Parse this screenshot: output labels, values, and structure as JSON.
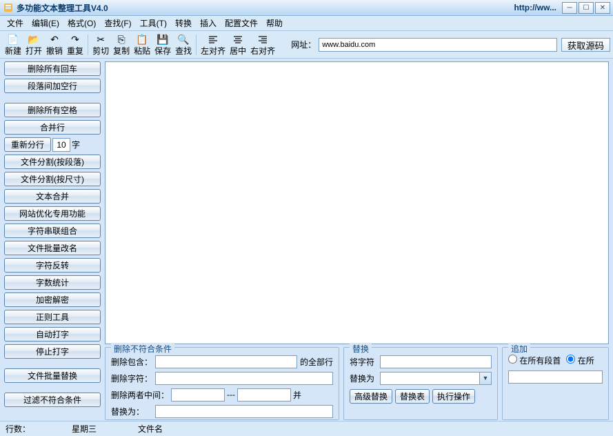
{
  "titlebar": {
    "title": "多功能文本整理工具V4.0",
    "url_trunc": "http://ww..."
  },
  "menu": {
    "file": "文件",
    "edit": "编辑(E)",
    "format": "格式(O)",
    "find": "查找(F)",
    "tools": "工具(T)",
    "convert": "转换",
    "insert": "插入",
    "config": "配置文件",
    "help": "帮助"
  },
  "toolbar": {
    "new": "新建",
    "open": "打开",
    "undo": "撤销",
    "redo": "重复",
    "cut": "剪切",
    "copy": "复制",
    "paste": "粘贴",
    "save": "保存",
    "find": "查找",
    "alignl": "左对齐",
    "alignc": "居中",
    "alignr": "右对齐",
    "url_label": "网址：",
    "url_value": "www.baidu.com",
    "get_src": "获取源码"
  },
  "sidebar": {
    "del_all_cr": "删除所有回车",
    "para_space": "段落间加空行",
    "del_all_sp": "删除所有空格",
    "merge_line": "合并行",
    "resplit": "重新分行",
    "resplit_val": "10",
    "resplit_unit": "字",
    "split_para": "文件分割(按段落)",
    "split_size": "文件分割(按尺寸)",
    "text_merge": "文本合并",
    "web_opt": "网站优化专用功能",
    "char_join": "字符串联组合",
    "batch_rename": "文件批量改名",
    "char_rev": "字符反转",
    "char_count": "字数统计",
    "enc_dec": "加密解密",
    "regex": "正则工具",
    "auto_type": "自动打字",
    "stop_type": "停止打字",
    "batch_replace": "文件批量替换",
    "filter": "过滤不符合条件"
  },
  "panels": {
    "del": {
      "title": "删除不符合条件",
      "contains": "删除包含：",
      "contains_suffix": "的全部行",
      "chars": "删除字符：",
      "between": "删除两者中间：",
      "between_sep": "---",
      "between_suffix": "并",
      "replace_to": "替换为："
    },
    "rep": {
      "title": "替换",
      "from": "将字符",
      "to": "替换为",
      "adv": "高级替换",
      "table": "替换表",
      "exec": "执行操作"
    },
    "add": {
      "title": "追加",
      "all_para_head": "在所有段首",
      "at": "在所"
    }
  },
  "status": {
    "lines": "行数：",
    "weekday": "星期三",
    "filename": "文件名"
  }
}
